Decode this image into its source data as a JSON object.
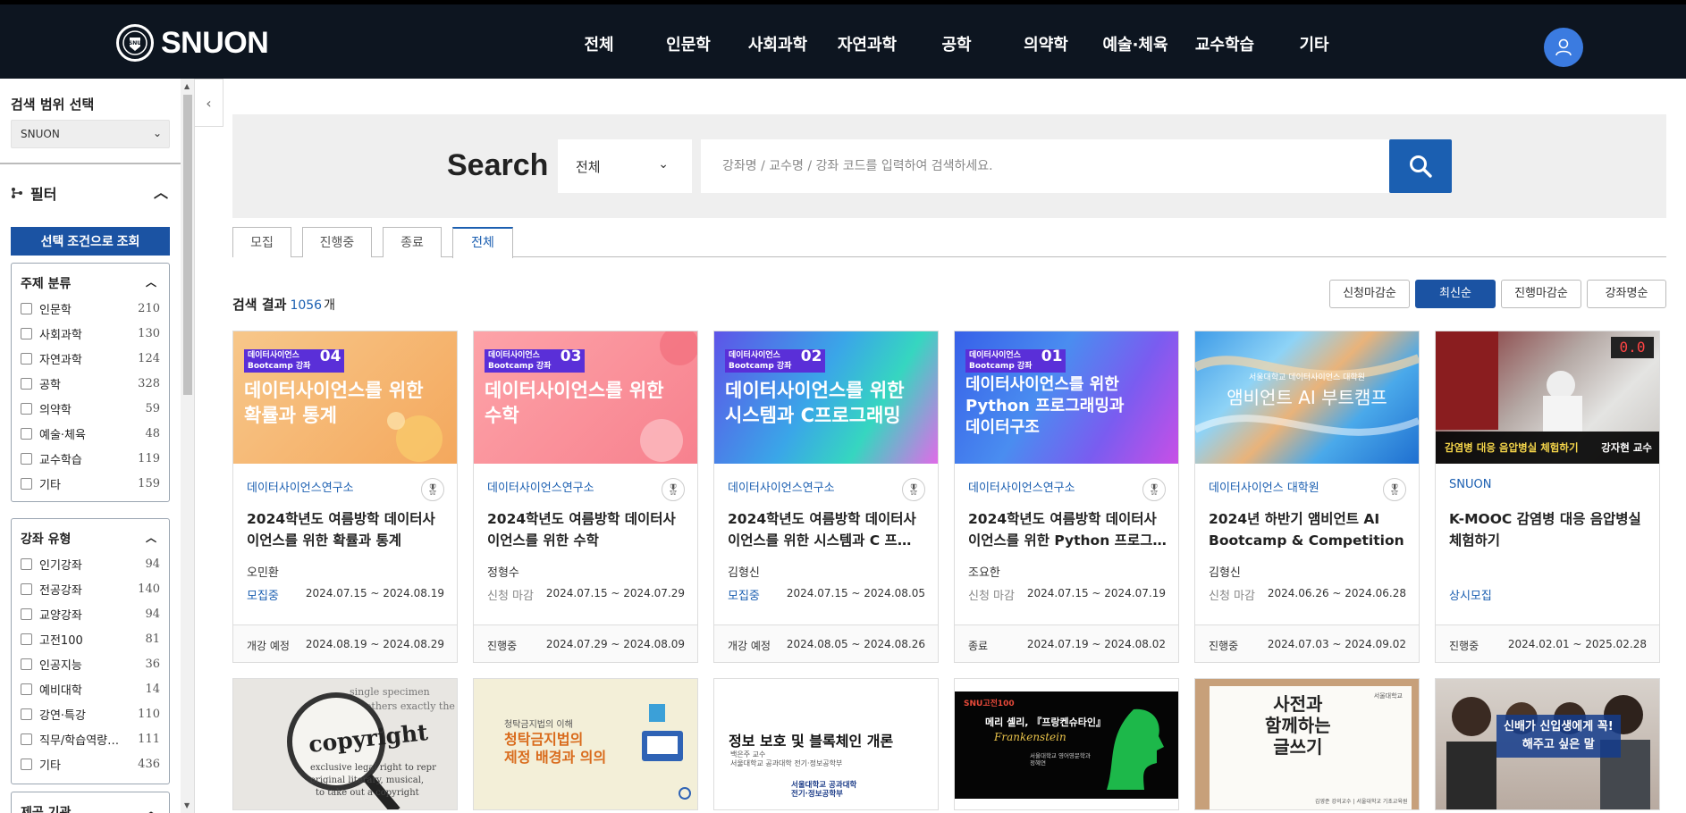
{
  "header": {
    "logo_text": "SNUON",
    "nav": [
      "전체",
      "인문학",
      "사회과학",
      "자연과학",
      "공학",
      "의약학",
      "예술·체육",
      "교수학습",
      "기타"
    ]
  },
  "sidebar": {
    "scope_title": "검색 범위 선택",
    "scope_value": "SNUON",
    "filter_title": "필터",
    "apply_label": "선택 조건으로 조회",
    "subject": {
      "title": "주제 분류",
      "items": [
        {
          "label": "인문학",
          "count": "210"
        },
        {
          "label": "사회과학",
          "count": "130"
        },
        {
          "label": "자연과학",
          "count": "124"
        },
        {
          "label": "공학",
          "count": "328"
        },
        {
          "label": "의약학",
          "count": "59"
        },
        {
          "label": "예술·체육",
          "count": "48"
        },
        {
          "label": "교수학습",
          "count": "119"
        },
        {
          "label": "기타",
          "count": "159"
        }
      ]
    },
    "type": {
      "title": "강좌 유형",
      "items": [
        {
          "label": "인기강좌",
          "count": "94"
        },
        {
          "label": "전공강좌",
          "count": "140"
        },
        {
          "label": "교양강좌",
          "count": "94"
        },
        {
          "label": "고전100",
          "count": "81"
        },
        {
          "label": "인공지능",
          "count": "36"
        },
        {
          "label": "예비대학",
          "count": "14"
        },
        {
          "label": "강연·특강",
          "count": "110"
        },
        {
          "label": "직무/학습역량…",
          "count": "111"
        },
        {
          "label": "기타",
          "count": "436"
        }
      ]
    },
    "provider_title": "제공 기관"
  },
  "search": {
    "title": "Search",
    "category": "전체",
    "placeholder": "강좌명 / 교수명 / 강좌 코드를 입력하여 검색하세요."
  },
  "tabs": [
    "모집",
    "진행중",
    "종료",
    "전체"
  ],
  "active_tab": "전체",
  "results": {
    "label": "검색 결과",
    "count": "1056",
    "unit": "개"
  },
  "sort": [
    "신청마감순",
    "최신순",
    "진행마감순",
    "강좌명순"
  ],
  "active_sort": "최신순",
  "cards": [
    {
      "badge": "데이터사이언스\nBootcamp 강좌",
      "badge_num": "04",
      "thumb_title": "데이터사이언스를 위한\n확률과 통계",
      "institution": "데이터사이언스연구소",
      "title": "2024학년도 여름방학 데이터사이언스를 위한 확률과 통계",
      "professor": "오민환",
      "status": "모집중",
      "apply_dates": "2024.07.15 ~ 2024.08.19",
      "course_status": "개강 예정",
      "course_dates": "2024.08.19 ~ 2024.08.29"
    },
    {
      "badge": "데이터사이언스\nBootcamp 강좌",
      "badge_num": "03",
      "thumb_title": "데이터사이언스를 위한\n수학",
      "institution": "데이터사이언스연구소",
      "title": "2024학년도 여름방학 데이터사이언스를 위한 수학",
      "professor": "정형수",
      "status": "신청 마감",
      "apply_dates": "2024.07.15 ~ 2024.07.29",
      "course_status": "진행중",
      "course_dates": "2024.07.29 ~ 2024.08.09"
    },
    {
      "badge": "데이터사이언스\nBootcamp 강좌",
      "badge_num": "02",
      "thumb_title": "데이터사이언스를 위한\n시스템과 C프로그래밍",
      "institution": "데이터사이언스연구소",
      "title": "2024학년도 여름방학 데이터사이언스를 위한 시스템과 C 프…",
      "professor": "김형신",
      "status": "모집중",
      "apply_dates": "2024.07.15 ~ 2024.08.05",
      "course_status": "개강 예정",
      "course_dates": "2024.08.05 ~ 2024.08.26"
    },
    {
      "badge": "데이터사이언스\nBootcamp 강좌",
      "badge_num": "01",
      "thumb_title": "데이터사이언스를 위한\nPython 프로그래밍과\n데이터구조",
      "institution": "데이터사이언스연구소",
      "title": "2024학년도 여름방학 데이터사이언스를 위한 Python 프로그…",
      "professor": "조요한",
      "status": "신청 마감",
      "apply_dates": "2024.07.15 ~ 2024.07.19",
      "course_status": "종료",
      "course_dates": "2024.07.19 ~ 2024.08.02"
    },
    {
      "thumb_caption": "서울대학교 데이터사이언스 대학원",
      "thumb_title": "앰비언트 AI 부트캠프",
      "institution": "데이터사이언스 대학원",
      "title": "2024년 하반기 앰비언트 AI Bootcamp & Competition",
      "professor": "김형신",
      "status": "신청 마감",
      "apply_dates": "2024.06.26 ~ 2024.06.28",
      "course_status": "진행중",
      "course_dates": "2024.07.03 ~ 2024.09.02"
    },
    {
      "thumb_title": "감염병 대응 음압병실 체험하기",
      "thumb_prof": "강자현 교수",
      "thumb_digits": "0.0",
      "institution": "SNUON",
      "title": "K-MOOC 감염병 대응 음압병실 체험하기",
      "professor": "",
      "status": "상시모집",
      "apply_dates": "",
      "course_status": "진행중",
      "course_dates": "2024.02.01 ~ 2025.02.28"
    }
  ],
  "row2": [
    {
      "text": "copyright",
      "fragments": [
        "single specimen",
        "many others exactly the",
        "exclusive legal right to repr",
        "original literary, musical,",
        "to take out a copyright"
      ]
    },
    {
      "top": "청탁금지법의 이해",
      "text": "청탁금지법의\n제정 배경과 의의"
    },
    {
      "text": "정보 보호 및 블록체인 개론",
      "sub": "백은주 교수\n서울대학교 공과대학 전기·정보공학부",
      "foot": "서울대학교 공과대학\n전기·정보공학부"
    },
    {
      "brand": "SNU고전100",
      "text": "메리 셸리, 『프랑켄슈타인』",
      "accent": "Frankenstein",
      "sub": "서울대학교 영어영문학과\n정혜연"
    },
    {
      "text": "사전과\n함께하는\n글쓰기",
      "sub": "김영준 강의교수 | 서울대학교 기초교육원",
      "corner": "서울대학교"
    },
    {
      "text": "신배가 신입생에게 꼭!\n해주고 싶은 말"
    }
  ]
}
